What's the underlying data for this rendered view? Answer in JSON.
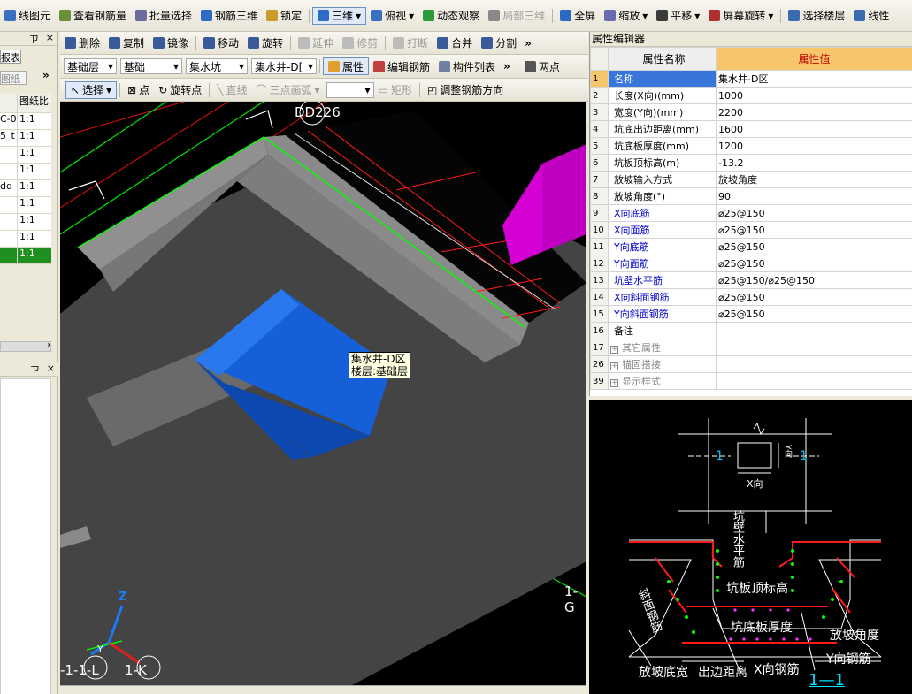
{
  "toolbar1": [
    {
      "label": "线图元",
      "icon": "element-icon"
    },
    {
      "label": "查看钢筋量",
      "icon": "rebar-qty-icon"
    },
    {
      "label": "批量选择",
      "icon": "batch-select-icon"
    },
    {
      "label": "钢筋三维",
      "icon": "rebar-3d-icon"
    },
    {
      "label": "锁定",
      "icon": "lock-icon"
    },
    {
      "label": "三维",
      "icon": "cube-3d-icon"
    },
    {
      "label": "俯视",
      "icon": "top-view-icon"
    },
    {
      "label": "动态观察",
      "icon": "orbit-icon"
    },
    {
      "label": "局部三维",
      "icon": "local-3d-icon"
    },
    {
      "label": "全屏",
      "icon": "fullscreen-icon"
    },
    {
      "label": "缩放",
      "icon": "zoom-icon"
    },
    {
      "label": "平移",
      "icon": "pan-icon"
    },
    {
      "label": "屏幕旋转",
      "icon": "screen-rotate-icon"
    },
    {
      "label": "选择楼层",
      "icon": "select-floor-icon"
    },
    {
      "label": "线性",
      "icon": "linear-icon"
    }
  ],
  "toolbar2": [
    {
      "label": "删除",
      "icon": "delete-icon"
    },
    {
      "label": "复制",
      "icon": "copy-icon"
    },
    {
      "label": "镜像",
      "icon": "mirror-icon"
    },
    {
      "label": "移动",
      "icon": "move-icon"
    },
    {
      "label": "旋转",
      "icon": "rotate-icon"
    },
    {
      "label": "延伸",
      "icon": "extend-icon"
    },
    {
      "label": "修剪",
      "icon": "trim-icon"
    },
    {
      "label": "打断",
      "icon": "break-icon"
    },
    {
      "label": "合并",
      "icon": "merge-icon"
    },
    {
      "label": "分割",
      "icon": "split-icon"
    }
  ],
  "toolbar3": {
    "floor_select": "基础层",
    "category_select": "基础",
    "type_select": "集水坑",
    "component_select": "集水井-D[",
    "attr_button": "属性",
    "edit_rebar": "编辑钢筋",
    "component_list": "构件列表",
    "two_points": "两点"
  },
  "toolbar4": {
    "select": "选择",
    "point": "点",
    "rotate_point": "旋转点",
    "line": "直线",
    "arc": "三点画弧",
    "rect": "矩形",
    "adjust": "调整钢筋方向"
  },
  "left_panel": {
    "top_label": "报表",
    "button_label": "图纸",
    "header": "图纸比",
    "rows": [
      {
        "a": "C-0",
        "b": "1:1"
      },
      {
        "a": "5_t",
        "b": "1:1"
      },
      {
        "a": "",
        "b": "1:1"
      },
      {
        "a": "",
        "b": "1:1"
      },
      {
        "a": "dd",
        "b": "1:1"
      },
      {
        "a": "",
        "b": "1:1"
      },
      {
        "a": "",
        "b": "1:1"
      },
      {
        "a": "",
        "b": "1:1"
      },
      {
        "a": "",
        "b": "1:1"
      }
    ],
    "pin": "ㄗ",
    "close": "×"
  },
  "viewport": {
    "top_label": "DD226",
    "tooltip_line1": "集水井-D区",
    "tooltip_line2": "楼层:基础层",
    "axis_labels": [
      "-1-1-L",
      "1-K",
      "1-G"
    ],
    "axis_z": "Z",
    "axis_y": "Y"
  },
  "property_editor": {
    "title": "属性编辑器",
    "col_name": "属性名称",
    "col_value": "属性值",
    "rows": [
      {
        "n": "1",
        "name": "名称",
        "value": "集水井-D区",
        "style": "sel"
      },
      {
        "n": "2",
        "name": "长度(X向)(mm)",
        "value": "1000",
        "style": ""
      },
      {
        "n": "3",
        "name": "宽度(Y向)(mm)",
        "value": "2200",
        "style": ""
      },
      {
        "n": "4",
        "name": "坑底出边距离(mm)",
        "value": "1600",
        "style": ""
      },
      {
        "n": "5",
        "name": "坑底板厚度(mm)",
        "value": "1200",
        "style": ""
      },
      {
        "n": "6",
        "name": "坑板顶标高(m)",
        "value": "-13.2",
        "style": ""
      },
      {
        "n": "7",
        "name": "放坡输入方式",
        "value": "放坡角度",
        "style": ""
      },
      {
        "n": "8",
        "name": "放坡角度(°)",
        "value": "90",
        "style": ""
      },
      {
        "n": "9",
        "name": "X向底筋",
        "value": "⌀25@150",
        "style": "blue"
      },
      {
        "n": "10",
        "name": "X向面筋",
        "value": "⌀25@150",
        "style": "blue"
      },
      {
        "n": "11",
        "name": "Y向底筋",
        "value": "⌀25@150",
        "style": "blue"
      },
      {
        "n": "12",
        "name": "Y向面筋",
        "value": "⌀25@150",
        "style": "blue"
      },
      {
        "n": "13",
        "name": "坑壁水平筋",
        "value": "⌀25@150/⌀25@150",
        "style": "blue"
      },
      {
        "n": "14",
        "name": "X向斜面钢筋",
        "value": "⌀25@150",
        "style": "blue"
      },
      {
        "n": "15",
        "name": "Y向斜面钢筋",
        "value": "⌀25@150",
        "style": "blue"
      },
      {
        "n": "16",
        "name": "备注",
        "value": "",
        "style": ""
      },
      {
        "n": "17",
        "name": "其它属性",
        "value": "",
        "style": "group"
      },
      {
        "n": "26",
        "name": "锚固搭接",
        "value": "",
        "style": "group"
      },
      {
        "n": "39",
        "name": "显示样式",
        "value": "",
        "style": "group"
      }
    ]
  },
  "diagram": {
    "plan_left": "1",
    "plan_right": "1",
    "plan_x": "X向",
    "plan_y": "Y向",
    "wall_rebar": "坑壁水平筋",
    "top_elev": "坑板顶标高",
    "slope_rebar": "斜面钢筋",
    "bottom_thick": "坑底板厚度",
    "slope_angle": "放坡角度",
    "y_rebar": "Y向钢筋",
    "slope_width": "放坡底宽",
    "edge_dist": "出边距离",
    "x_rebar": "X向钢筋",
    "section": "1—1"
  },
  "colors": {
    "selected_row": "#3976d9",
    "header_value": "#f7c66a",
    "pit_block": "#1560d8",
    "magenta_block": "#c000c0",
    "green_line": "#00ff00",
    "red_rebar": "#ff0000"
  }
}
